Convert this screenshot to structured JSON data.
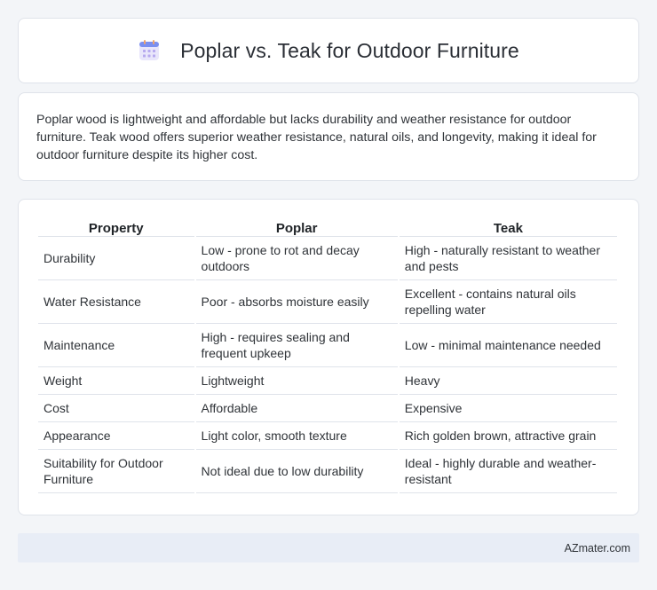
{
  "header": {
    "title": "Poplar vs. Teak for Outdoor Furniture",
    "icon": "calendar-icon",
    "icon_color": "#7b8ff0"
  },
  "description": "Poplar wood is lightweight and affordable but lacks durability and weather resistance for outdoor furniture. Teak wood offers superior weather resistance, natural oils, and longevity, making it ideal for outdoor furniture despite its higher cost.",
  "table": {
    "columns": [
      "Property",
      "Poplar",
      "Teak"
    ],
    "rows": [
      [
        "Durability",
        "Low - prone to rot and decay outdoors",
        "High - naturally resistant to weather and pests"
      ],
      [
        "Water Resistance",
        "Poor - absorbs moisture easily",
        "Excellent - contains natural oils repelling water"
      ],
      [
        "Maintenance",
        "High - requires sealing and frequent upkeep",
        "Low - minimal maintenance needed"
      ],
      [
        "Weight",
        "Lightweight",
        "Heavy"
      ],
      [
        "Cost",
        "Affordable",
        "Expensive"
      ],
      [
        "Appearance",
        "Light color, smooth texture",
        "Rich golden brown, attractive grain"
      ],
      [
        "Suitability for Outdoor Furniture",
        "Not ideal due to low durability",
        "Ideal - highly durable and weather-resistant"
      ]
    ]
  },
  "footer": {
    "brand": "AZmater.com"
  }
}
